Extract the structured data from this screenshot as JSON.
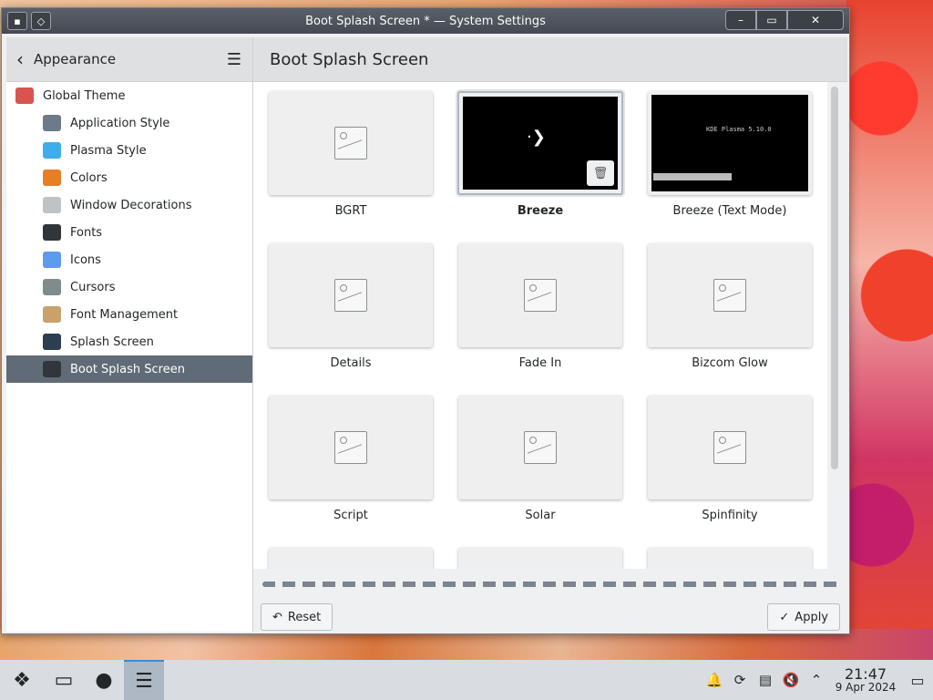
{
  "window": {
    "title": "Boot Splash Screen * — System Settings",
    "minimize_icon": "window-minimize-icon",
    "maximize_icon": "window-maximize-icon",
    "close_icon": "window-close-icon"
  },
  "sidebar": {
    "section": "Appearance",
    "items": [
      {
        "label": "Global Theme",
        "icon": "global-theme-icon",
        "color": "#d9534f"
      },
      {
        "label": "Application Style",
        "icon": "application-style-icon",
        "color": "#6c7a89"
      },
      {
        "label": "Plasma Style",
        "icon": "plasma-style-icon",
        "color": "#3daee9"
      },
      {
        "label": "Colors",
        "icon": "colors-icon",
        "color": "#e67e22"
      },
      {
        "label": "Window Decorations",
        "icon": "window-decorations-icon",
        "color": "#bdc3c7"
      },
      {
        "label": "Fonts",
        "icon": "fonts-icon",
        "color": "#31363b"
      },
      {
        "label": "Icons",
        "icon": "icons-icon",
        "color": "#5d9cec"
      },
      {
        "label": "Cursors",
        "icon": "cursors-icon",
        "color": "#7f8c8d"
      },
      {
        "label": "Font Management",
        "icon": "font-management-icon",
        "color": "#c8a26a"
      },
      {
        "label": "Splash Screen",
        "icon": "splash-screen-icon",
        "color": "#2c3e50"
      },
      {
        "label": "Boot Splash Screen",
        "icon": "boot-splash-screen-icon",
        "color": "#31363b"
      }
    ],
    "active_index": 10
  },
  "main": {
    "title": "Boot Splash Screen",
    "themes": [
      {
        "name": "BGRT"
      },
      {
        "name": "Breeze",
        "selected": true
      },
      {
        "name": "Breeze (Text Mode)",
        "preview_text": "KDE Plasma 5.10.0"
      },
      {
        "name": "Details"
      },
      {
        "name": "Fade In"
      },
      {
        "name": "Bizcom Glow"
      },
      {
        "name": "Script"
      },
      {
        "name": "Solar"
      },
      {
        "name": "Spinfinity"
      }
    ],
    "reset_label": "Reset",
    "apply_label": "Apply"
  },
  "taskbar": {
    "clock_time": "21:47",
    "clock_date": "9 Apr 2024"
  }
}
